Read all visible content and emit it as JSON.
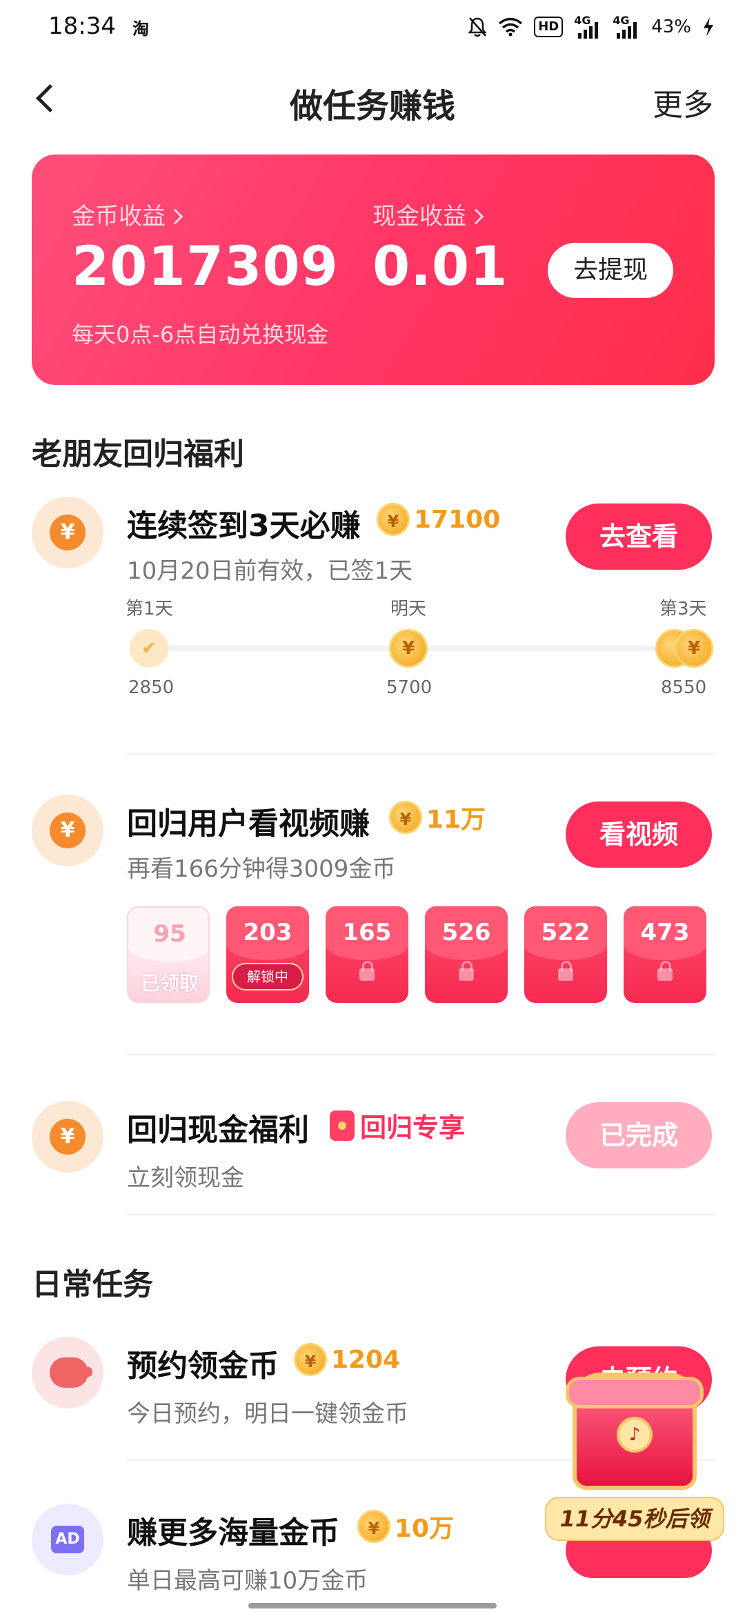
{
  "status_bar": {
    "time": "18:34",
    "app_glyph": "淘",
    "hd": "HD",
    "net1": "4G",
    "net2": "4G",
    "battery": "43%"
  },
  "header": {
    "title": "做任务赚钱",
    "more": "更多"
  },
  "earnings": {
    "coin_label": "金币收益",
    "coin_value": "2017309",
    "cash_label": "现金收益",
    "cash_value": "0.01",
    "withdraw": "去提现",
    "note": "每天0点-6点自动兑换现金"
  },
  "section_returning": "老朋友回归福利",
  "checkin": {
    "title": "连续签到3天必赚",
    "coins": "17100",
    "subtitle": "10月20日前有效，已签1天",
    "button": "去查看",
    "days": [
      {
        "label": "第1天",
        "amount": "2850",
        "checked": true
      },
      {
        "label": "明天",
        "amount": "5700",
        "checked": false
      },
      {
        "label": "第3天",
        "amount": "8550",
        "checked": false
      }
    ]
  },
  "video": {
    "title": "回归用户看视频赚",
    "coins": "11万",
    "subtitle": "再看166分钟得3009金币",
    "button": "看视频",
    "packets": [
      {
        "amount": "95",
        "status": "已领取"
      },
      {
        "amount": "203",
        "status": "解锁中"
      },
      {
        "amount": "165",
        "status": ""
      },
      {
        "amount": "526",
        "status": ""
      },
      {
        "amount": "522",
        "status": ""
      },
      {
        "amount": "473",
        "status": ""
      }
    ]
  },
  "cash_benefit": {
    "title": "回归现金福利",
    "tag": "回归专享",
    "subtitle": "立刻领现金",
    "button": "已完成"
  },
  "section_daily": "日常任务",
  "reserve": {
    "title": "预约领金币",
    "coins": "1204",
    "subtitle": "今日预约，明日一键领金币",
    "button": "去预约"
  },
  "more_coins": {
    "title": "赚更多海量金币",
    "coins": "10万",
    "subtitle": "单日最高可赚10万金币",
    "icon_text": "AD"
  },
  "floating": {
    "timer": "11分45秒后领"
  },
  "colors": {
    "accent": "#ff2f5c",
    "coin_text": "#f29a1a",
    "card_gradient_start": "#ff4f7b",
    "card_gradient_end": "#ff2e4a"
  },
  "icons": {
    "coin": "yuan-coin-icon",
    "currency_symbol": "¥"
  }
}
